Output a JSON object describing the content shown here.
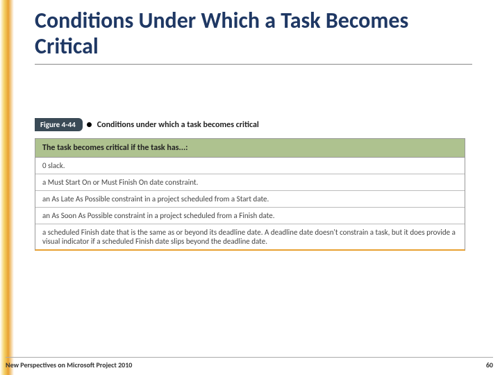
{
  "title": "Conditions Under Which a Task Becomes Critical",
  "figure": {
    "label": "Figure 4-44",
    "caption": "Conditions under which a task becomes critical",
    "header": "The task becomes critical if the task has...:",
    "rows": [
      "0 slack.",
      "a Must Start On or Must Finish On date constraint.",
      "an As Late As Possible constraint in a project scheduled from a Start date.",
      "an As Soon As Possible constraint in a project scheduled from a Finish date.",
      "a scheduled Finish date that is the same as or beyond its deadline date. A deadline date doesn't constrain a task, but it does provide a visual indicator if a scheduled Finish date slips beyond the deadline date."
    ]
  },
  "footer": {
    "source": "New Perspectives on Microsoft Project 2010",
    "page": "60"
  }
}
